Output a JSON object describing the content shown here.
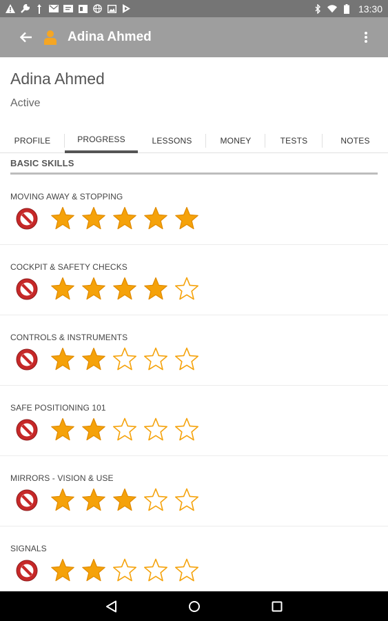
{
  "status_bar": {
    "time": "13:30",
    "left_icons": [
      "warning-icon",
      "wrench-icon",
      "usb-icon",
      "email-icon",
      "message-icon",
      "card-icon",
      "globe-icon",
      "image-icon",
      "play-store-icon"
    ],
    "right_icons": [
      "bluetooth-icon",
      "wifi-icon",
      "battery-icon"
    ]
  },
  "app_bar": {
    "title": "Adina Ahmed",
    "avatar_color": "#f5a623"
  },
  "student": {
    "name": "Adina Ahmed",
    "status": "Active"
  },
  "tabs": [
    {
      "label": "PROFILE",
      "active": false
    },
    {
      "label": "PROGRESS",
      "active": true
    },
    {
      "label": "LESSONS",
      "active": false
    },
    {
      "label": "MONEY",
      "active": false
    },
    {
      "label": "TESTS",
      "active": false
    },
    {
      "label": "NOTES",
      "active": false
    }
  ],
  "section": {
    "title": "BASIC SKILLS"
  },
  "skills": [
    {
      "label": "MOVING AWAY & STOPPING",
      "rating": 5,
      "max": 5
    },
    {
      "label": "COCKPIT & SAFETY CHECKS",
      "rating": 4,
      "max": 5
    },
    {
      "label": "CONTROLS & INSTRUMENTS",
      "rating": 2,
      "max": 5
    },
    {
      "label": "SAFE POSITIONING 101",
      "rating": 2,
      "max": 5
    },
    {
      "label": "MIRRORS - VISION & USE",
      "rating": 3,
      "max": 5
    },
    {
      "label": "SIGNALS",
      "rating": 2,
      "max": 5
    }
  ],
  "colors": {
    "star_fill": "#f5a20a",
    "star_outline": "#f5a20a",
    "reset_red": "#c62828",
    "app_bar": "#9e9e9e",
    "status_bar": "#757575"
  }
}
